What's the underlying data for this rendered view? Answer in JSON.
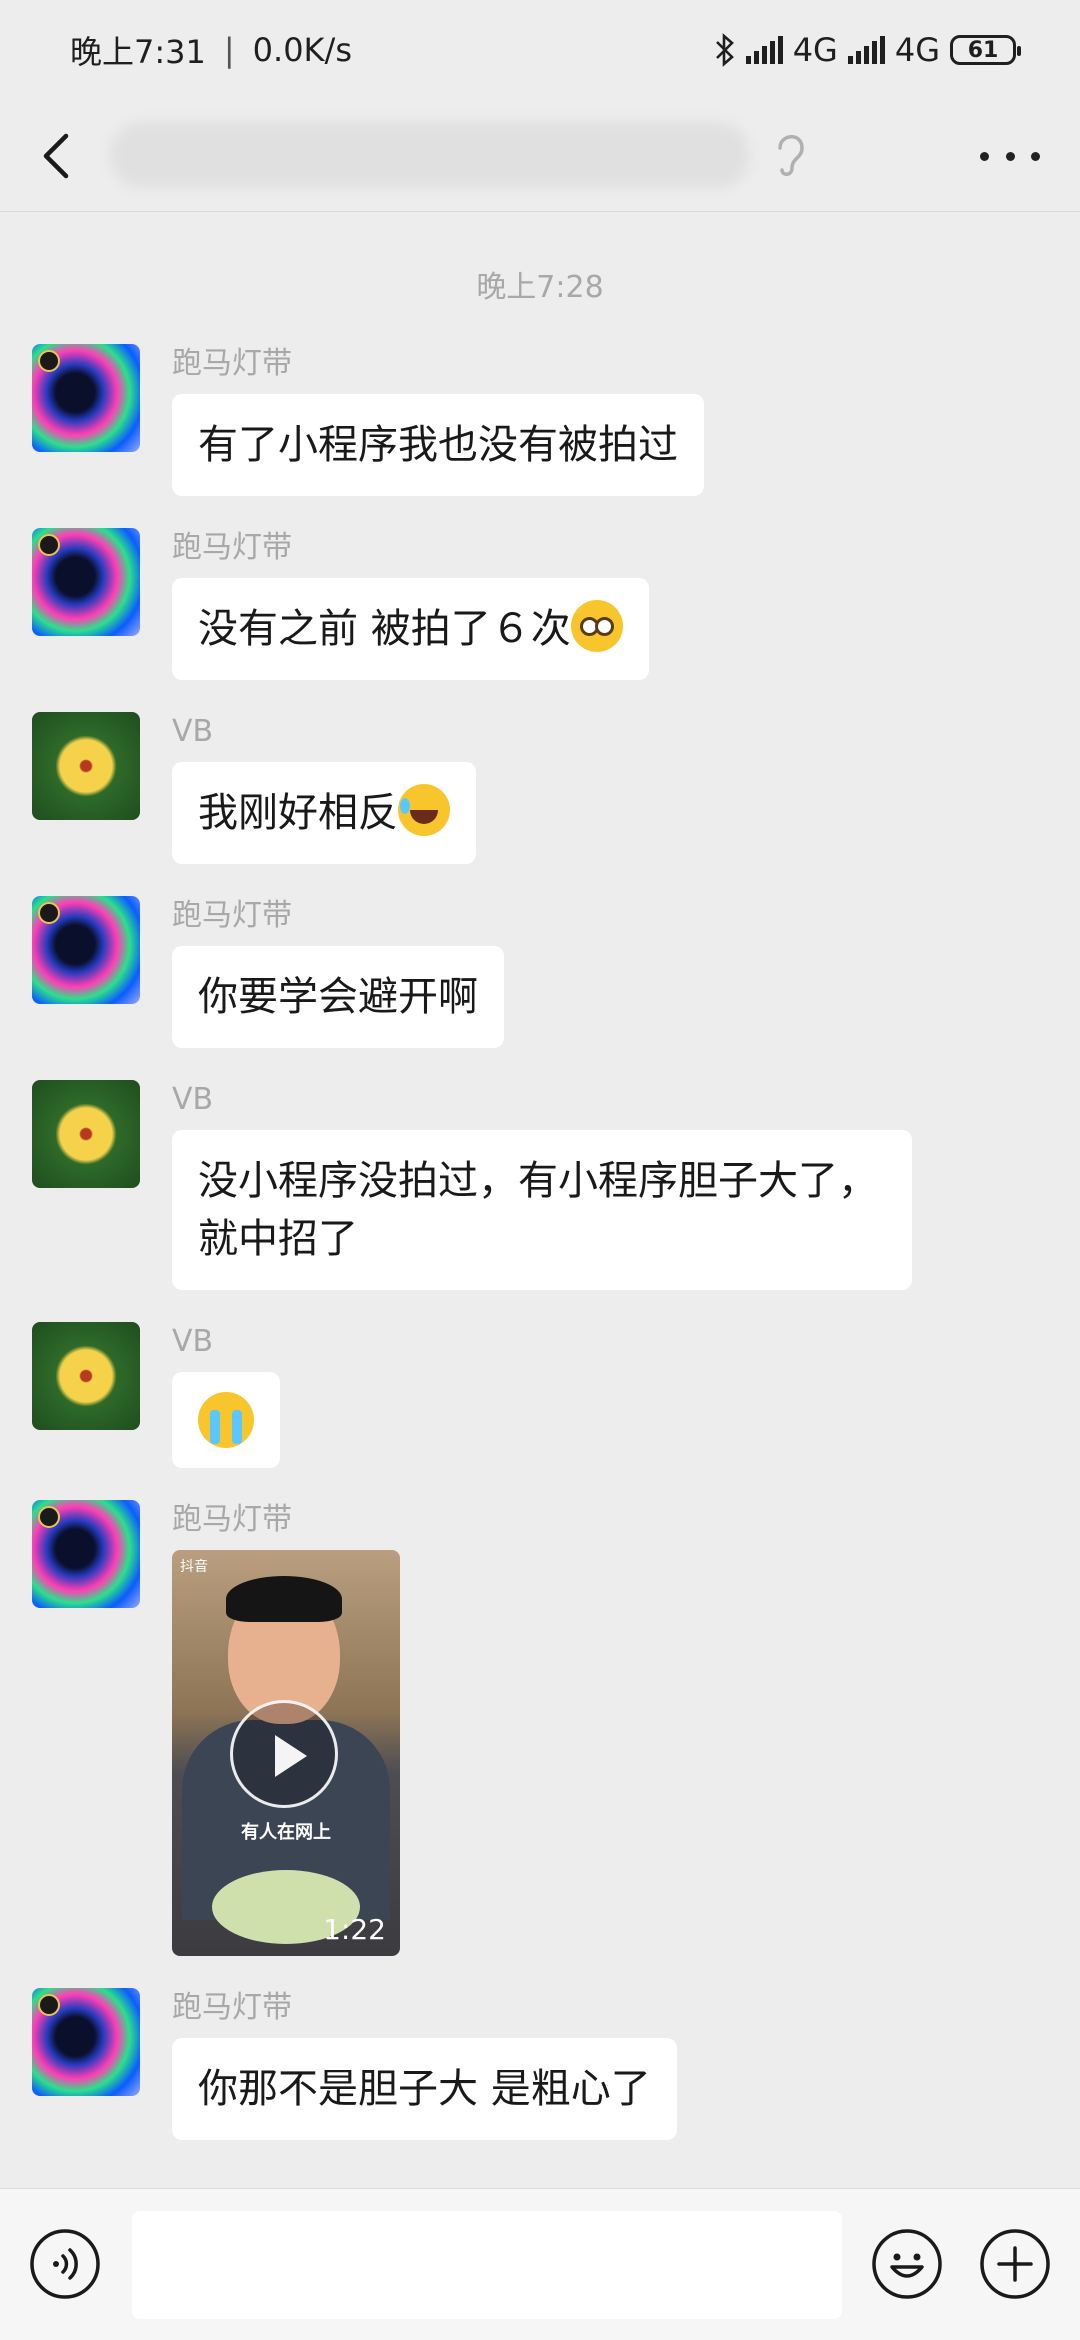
{
  "status_bar": {
    "time": "晚上7:31",
    "net_speed": "0.0K/s",
    "net_label_1": "4G",
    "net_label_2": "4G",
    "battery": "61"
  },
  "header": {
    "title": "",
    "icons": [
      "back-icon",
      "ear-icon",
      "more-icon"
    ]
  },
  "chat": {
    "timestamp": "晚上7:28",
    "messages": [
      {
        "sender": "跑马灯带",
        "avatar": "led-strip",
        "text": "有了小程序我也没有被拍过"
      },
      {
        "sender": "跑马灯带",
        "avatar": "led-strip",
        "text": "没有之前 被拍了６次",
        "emoji": "pleading-face"
      },
      {
        "sender": "VB",
        "avatar": "yellow-flower",
        "text": "我刚好相反",
        "emoji": "laughing-tears"
      },
      {
        "sender": "跑马灯带",
        "avatar": "led-strip",
        "text": "你要学会避开啊"
      },
      {
        "sender": "VB",
        "avatar": "yellow-flower",
        "text": "没小程序没拍过，有小程序胆子大了，就中招了"
      },
      {
        "sender": "VB",
        "avatar": "yellow-flower",
        "emoji": "crying-face"
      },
      {
        "sender": "跑马灯带",
        "avatar": "led-strip",
        "video": {
          "caption": "有人在网上",
          "logo": "抖音",
          "duration": "1:22"
        }
      },
      {
        "sender": "跑马灯带",
        "avatar": "led-strip",
        "text": "你那不是胆子大 是粗心了"
      }
    ]
  },
  "input_bar": {
    "placeholder": "",
    "icons": [
      "voice-icon",
      "emoji-icon",
      "plus-icon"
    ]
  }
}
